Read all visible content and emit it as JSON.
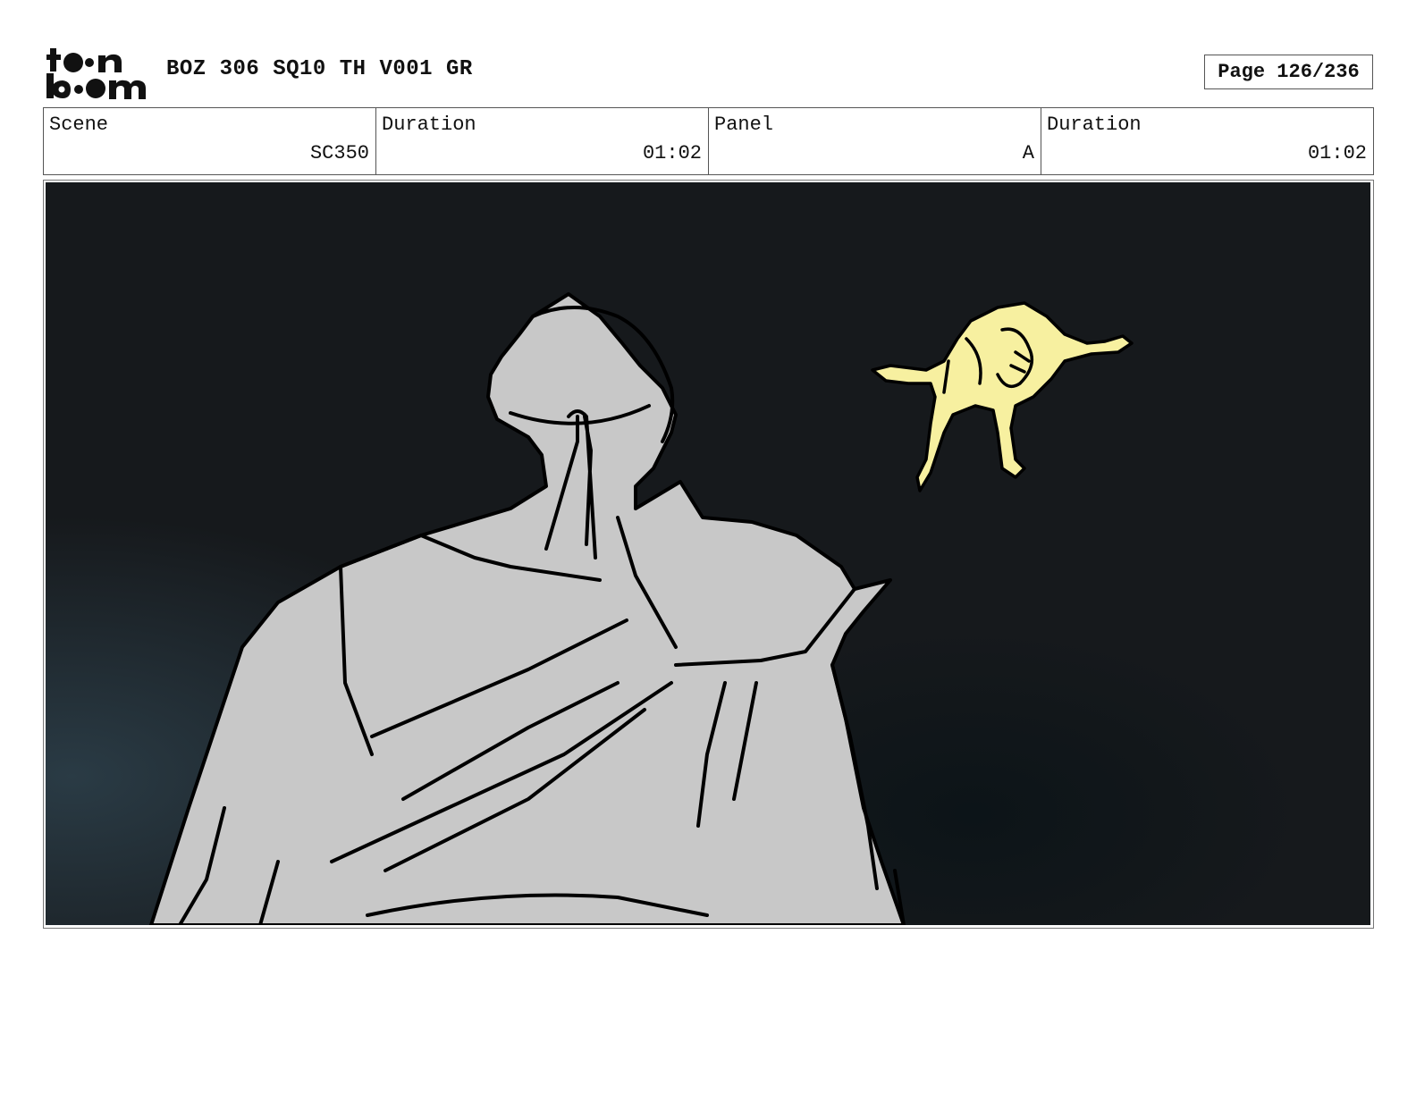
{
  "header": {
    "logo_text": "toon boom",
    "doc_title": "BOZ 306 SQ10 TH V001 GR",
    "page_label": "Page 126/236"
  },
  "info": {
    "scene_label": "Scene",
    "scene_value": "SC350",
    "scene_duration_label": "Duration",
    "scene_duration_value": "01:02",
    "panel_label": "Panel",
    "panel_value": "A",
    "panel_duration_label": "Duration",
    "panel_duration_value": "01:02"
  },
  "panel": {
    "background_color": "#16191c",
    "foreground_figure_color": "#c8c8c8",
    "falling_figure_color": "#f7f0a0"
  }
}
